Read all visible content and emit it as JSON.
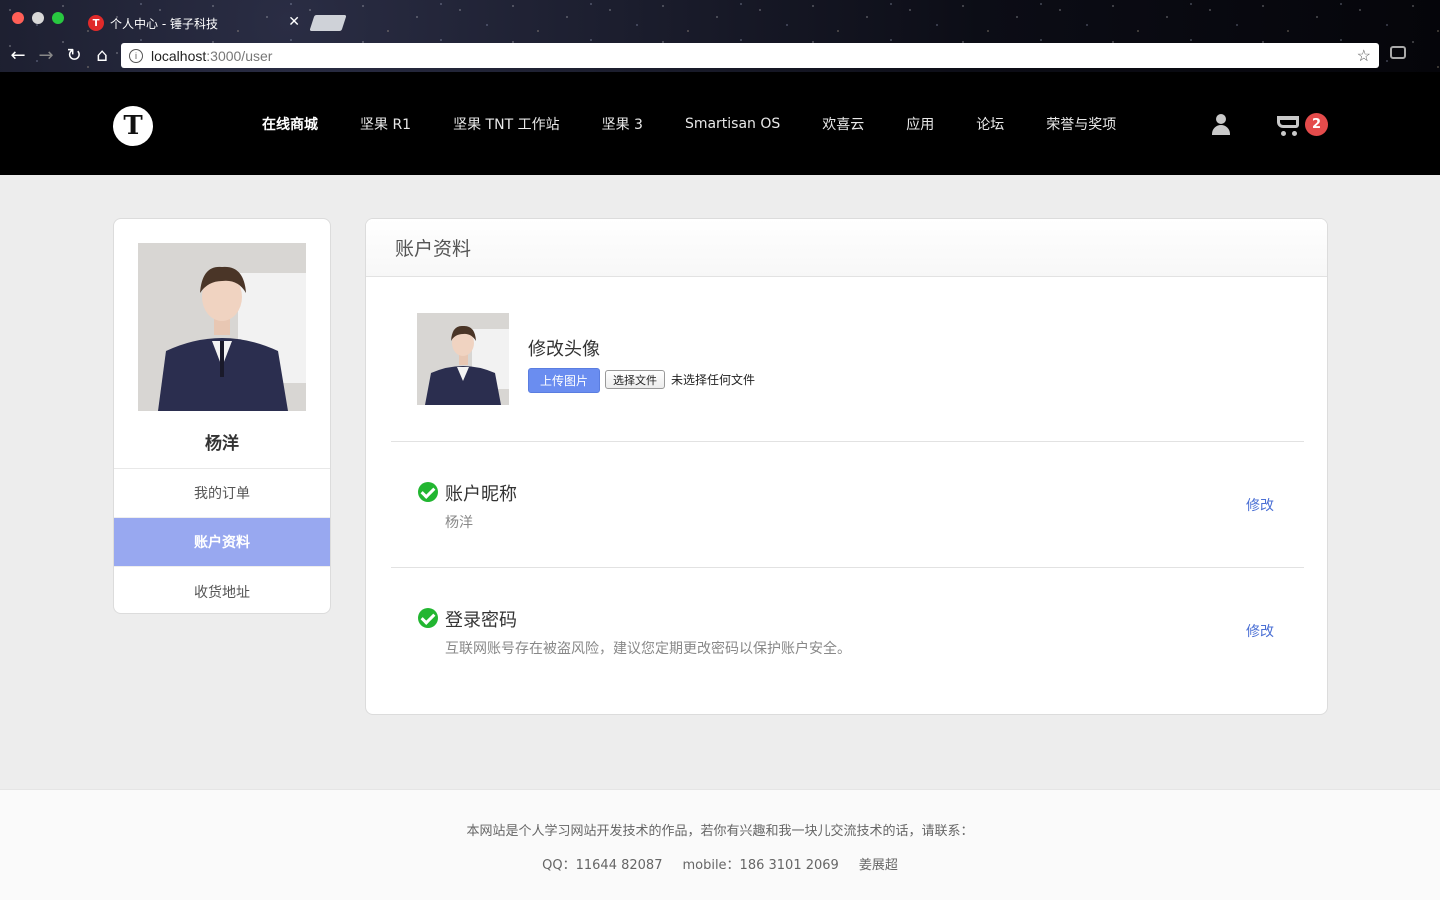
{
  "browser": {
    "tab_title": "个人中心 - 锤子科技",
    "tab_favicon": "T",
    "url_host": "localhost",
    "url_path": ":3000/user"
  },
  "header": {
    "logo": "T",
    "nav": [
      "在线商城",
      "坚果 R1",
      "坚果 TNT 工作站",
      "坚果 3",
      "Smartisan OS",
      "欢喜云",
      "应用",
      "论坛",
      "荣誉与奖项"
    ],
    "cart_count": "2"
  },
  "sidebar": {
    "user_name": "杨洋",
    "menu": [
      "我的订单",
      "账户资料",
      "收货地址"
    ]
  },
  "panel": {
    "title": "账户资料",
    "avatar_title": "修改头像",
    "upload_button": "上传图片",
    "file_button": "选择文件",
    "file_status": "未选择任何文件",
    "nickname_title": "账户昵称",
    "nickname_value": "杨洋",
    "password_title": "登录密码",
    "password_desc": "互联网账号存在被盗风险，建议您定期更改密码以保护账户安全。",
    "edit_label": "修改"
  },
  "footer": {
    "line1": "本网站是个人学习网站开发技术的作品，若你有兴趣和我一块儿交流技术的话，请联系：",
    "qq": "QQ：11644 82087",
    "mobile": "mobile：186 3101 2069",
    "author": "姜展超"
  },
  "colors": {
    "accent": "#98a8f0",
    "upload_button": "#6a8df0",
    "link": "#4a6fd4",
    "check": "#22b631",
    "badge": "#e44b4b"
  }
}
